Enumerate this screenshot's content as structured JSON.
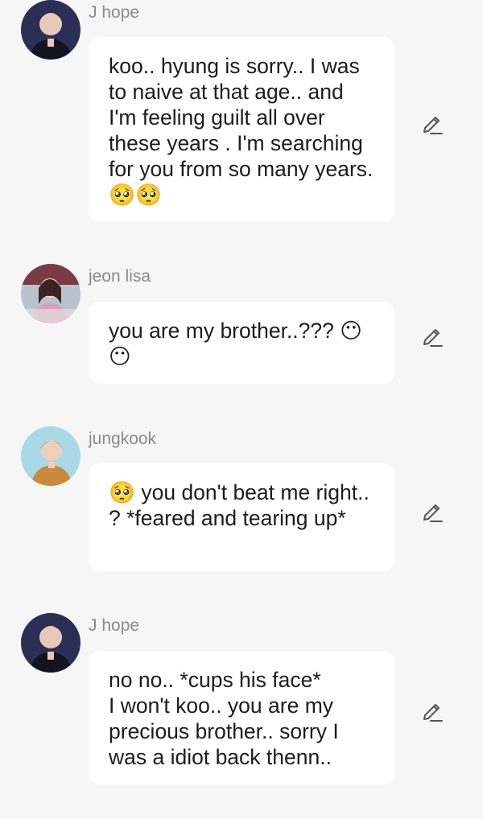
{
  "messages": [
    {
      "author": "J hope",
      "avatar": "jhope-avatar",
      "text": "koo.. hyung is sorry.. I was to naive at that age.. and I'm feeling guilt all over these years . I'm searching for you from so many years.  🥺🥺"
    },
    {
      "author": "jeon lisa",
      "avatar": "lisa-avatar",
      "text": "you are my brother..??? 😶 😶"
    },
    {
      "author": "jungkook",
      "avatar": "jungkook-avatar",
      "text": "🥺 you don't beat me right.. ? *feared and tearing up*"
    },
    {
      "author": "J hope",
      "avatar": "jhope-avatar",
      "text": "no no.. *cups his face*\nI won't koo.. you are my precious brother.. sorry I was a idiot back thenn.."
    }
  ],
  "icons": {
    "edit": "pencil-icon"
  },
  "colors": {
    "background": "#f6f6f6",
    "bubble": "#ffffff",
    "author_name": "#8a8a8a",
    "message_text": "#1c1c1c"
  }
}
